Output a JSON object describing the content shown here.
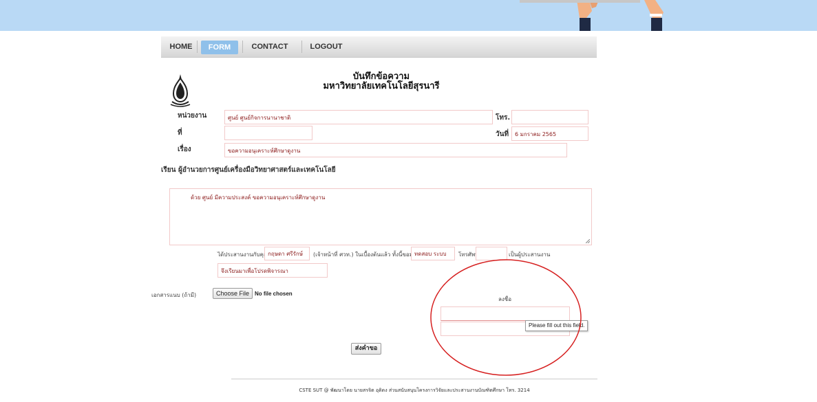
{
  "nav": {
    "items": [
      {
        "label": "HOME"
      },
      {
        "label": "FORM"
      },
      {
        "label": "CONTACT US"
      },
      {
        "label": "LOGOUT"
      }
    ],
    "active_index": 1
  },
  "memo": {
    "title_line1": "บันทึกข้อความ",
    "title_line2": "มหาวิทยาลัยเทคโนโลยีสุรนารี"
  },
  "form": {
    "unit_label": "หน่วยงาน",
    "unit_value": "ศูนย์ ศูนย์กิจการนานาชาติ",
    "phone_label": "โทร.",
    "phone_value": "",
    "number_label": "ที่",
    "number_value": "",
    "date_label": "วันที่",
    "date_value": "6 มกราคม 2565",
    "subject_label": "เรื่อง",
    "subject_value": "ขอความอนุเคราะห์ศึกษาดูงาน",
    "salutation": "เรียน ผู้อำนวยการศูนย์เครื่องมือวิทยาศาสตร์และเทคโนโลยี",
    "body_text": "ด้วย ศูนย์ มีความประสงค์ ขอความอนุเคราะห์ศึกษาดูงาน",
    "coord_prefix": "ได้ประสานงานกับคุณ",
    "coord_name": "กฤษดา ศรีรักษ์",
    "coord_mid": "(เจ้าหน้าที่ ศวท.) ในเบื้องต้นแล้ว ทั้งนี้ขอมอบให้",
    "coord_person": "ทดสอบ ระบบ",
    "coord_phone_label": "โทรศัพท์",
    "coord_phone_value": "",
    "coord_suffix": "เป็นผู้ประสานงาน",
    "closing": "จึงเรียนมาเพื่อโปรดพิจารณา",
    "attachment_label": "เอกสารแนบ (ถ้ามี)",
    "choose_file_label": "Choose File",
    "no_file_label": "No file chosen",
    "signature_label": "ลงชื่อ",
    "signature_value": "",
    "signature_position_value": "",
    "tooltip": "Please fill out this field.",
    "submit_label": "ส่งคำขอ"
  },
  "footer": {
    "text": "CSTE SUT @ พัฒนาโดย นายสรจิต อุดิดง ส่วนสนับสนุนโครงการวิจัยและประสานงานบัณฑิตศึกษา โทร. 3214"
  },
  "colors": {
    "top_band": "#b9d9f5",
    "nav_active": "#8fc0ea",
    "field_border": "#f2c9c9",
    "field_text": "#8b1a1a",
    "annotation_circle": "#d62020"
  }
}
